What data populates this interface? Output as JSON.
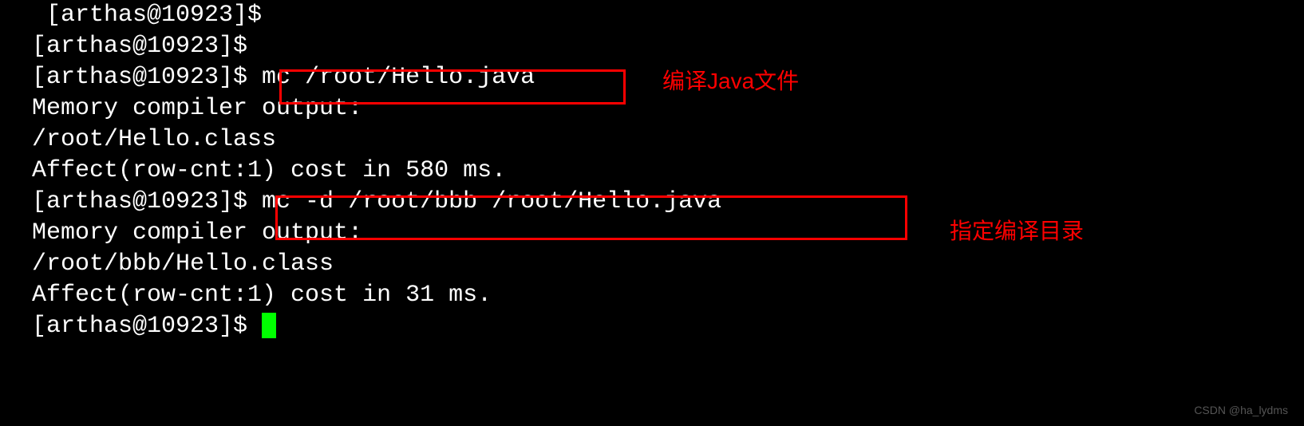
{
  "terminal": {
    "line_cut": " [arthas@10923]$",
    "prompt": "[arthas@10923]$",
    "empty_prompt_1": "[arthas@10923]$ ",
    "cmd1_line": "[arthas@10923]$ mc /root/Hello.java",
    "out1_line1": "Memory compiler output:",
    "out1_line2": "/root/Hello.class",
    "out1_line3": "Affect(row-cnt:1) cost in 580 ms.",
    "cmd2_line": "[arthas@10923]$ mc -d /root/bbb /root/Hello.java",
    "out2_line1": "Memory compiler output:",
    "out2_line2": "/root/bbb/Hello.class",
    "out2_line3": "Affect(row-cnt:1) cost in 31 ms.",
    "final_prompt": "[arthas@10923]$ "
  },
  "annotations": {
    "label1": "编译Java文件",
    "label2": "指定编译目录"
  },
  "watermark": "CSDN @ha_lydms"
}
